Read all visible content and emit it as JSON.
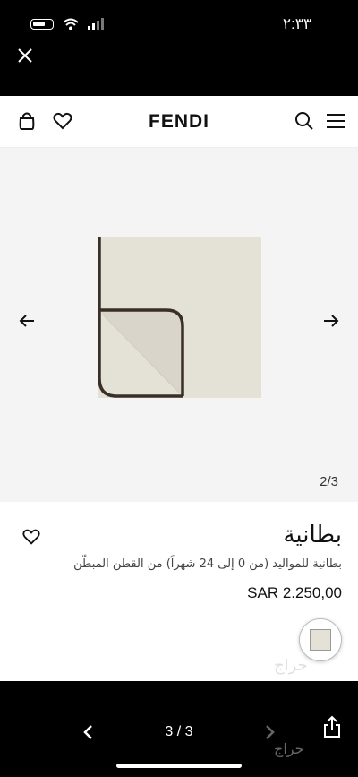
{
  "status": {
    "time": "٢:٣٣"
  },
  "header": {
    "brand": "FENDI"
  },
  "gallery": {
    "counter": "2/3"
  },
  "product": {
    "title": "بطانية",
    "description": "بطانية للمواليد (من 0 إلى 24 شهراً) من القطن المبطّن",
    "price": "SAR 2.250,00"
  },
  "viewer": {
    "page_indicator": "3 / 3"
  },
  "watermark": "حراج",
  "colors": {
    "background": "#000000",
    "gallery_bg": "#f4f4f4",
    "blanket": "#e4e1d7",
    "trim": "#3a2f28"
  }
}
